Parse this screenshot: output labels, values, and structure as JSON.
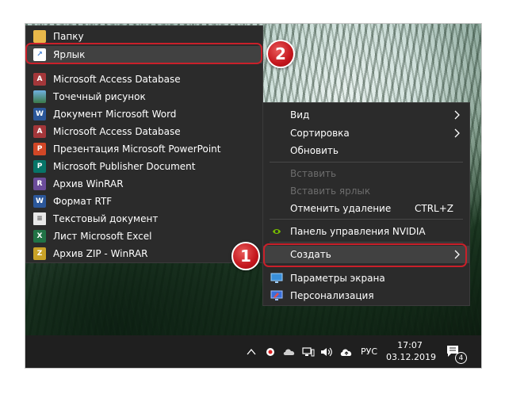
{
  "submenu": {
    "items": [
      {
        "label": "Папку",
        "icon": "folder-icon",
        "color": "#e8b84a"
      },
      {
        "label": "Ярлык",
        "icon": "shortcut-icon",
        "color": "#3a7bd5"
      },
      {
        "label": "Microsoft Access Database",
        "icon": "access-icon",
        "color": "#a4373a"
      },
      {
        "label": "Точечный рисунок",
        "icon": "bitmap-icon",
        "color": "#4a90c2"
      },
      {
        "label": "Документ Microsoft Word",
        "icon": "word-icon",
        "color": "#2b579a"
      },
      {
        "label": "Microsoft Access Database",
        "icon": "access-icon",
        "color": "#a4373a"
      },
      {
        "label": "Презентация Microsoft PowerPoint",
        "icon": "powerpoint-icon",
        "color": "#d24726"
      },
      {
        "label": "Microsoft Publisher Document",
        "icon": "publisher-icon",
        "color": "#077568"
      },
      {
        "label": "Архив WinRAR",
        "icon": "winrar-icon",
        "color": "#6b4c9a"
      },
      {
        "label": "Формат RTF",
        "icon": "rtf-icon",
        "color": "#2b579a"
      },
      {
        "label": "Текстовый документ",
        "icon": "text-document-icon",
        "color": "#e8e8e8"
      },
      {
        "label": "Лист Microsoft Excel",
        "icon": "excel-icon",
        "color": "#217346"
      },
      {
        "label": "Архив ZIP - WinRAR",
        "icon": "zip-icon",
        "color": "#c9a227"
      }
    ]
  },
  "context_menu": {
    "items": [
      {
        "label": "Вид",
        "shortcut": "",
        "has_submenu": true,
        "disabled": false
      },
      {
        "label": "Сортировка",
        "shortcut": "",
        "has_submenu": true,
        "disabled": false
      },
      {
        "label": "Обновить",
        "shortcut": "",
        "has_submenu": false,
        "disabled": false
      },
      {
        "label": "Вставить",
        "shortcut": "",
        "has_submenu": false,
        "disabled": true
      },
      {
        "label": "Вставить ярлык",
        "shortcut": "",
        "has_submenu": false,
        "disabled": true
      },
      {
        "label": "Отменить удаление",
        "shortcut": "CTRL+Z",
        "has_submenu": false,
        "disabled": false
      },
      {
        "label": "Панель управления NVIDIA",
        "shortcut": "",
        "has_submenu": false,
        "disabled": false
      },
      {
        "label": "Создать",
        "shortcut": "",
        "has_submenu": true,
        "disabled": false
      },
      {
        "label": "Параметры экрана",
        "shortcut": "",
        "has_submenu": false,
        "disabled": false
      },
      {
        "label": "Персонализация",
        "shortcut": "",
        "has_submenu": false,
        "disabled": false
      }
    ]
  },
  "annotations": {
    "step1": "1",
    "step2": "2",
    "color": "#c9202a"
  },
  "taskbar": {
    "language": "РУС",
    "time": "17:07",
    "date": "03.12.2019",
    "notification_count": "4"
  }
}
